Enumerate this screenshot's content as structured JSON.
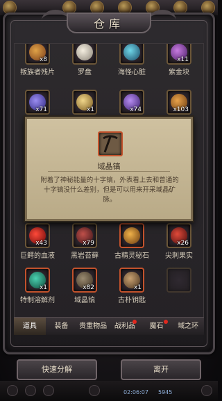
{
  "title": "仓库",
  "items": [
    {
      "name": "叛族者残片",
      "qty": "x8"
    },
    {
      "name": "罗盘",
      "qty": ""
    },
    {
      "name": "海怪心脏",
      "qty": ""
    },
    {
      "name": "紫金块",
      "qty": "x11"
    },
    {
      "name": "",
      "qty": "x71"
    },
    {
      "name": "",
      "qty": "x1"
    },
    {
      "name": "",
      "qty": "x74"
    },
    {
      "name": "",
      "qty": "x103"
    },
    {
      "name": "巨鳄的血液",
      "qty": "x43"
    },
    {
      "name": "黑岩苔藓",
      "qty": "x79"
    },
    {
      "name": "古精灵秘石",
      "qty": ""
    },
    {
      "name": "尖刺果实",
      "qty": "x26"
    },
    {
      "name": "特制溶解剂",
      "qty": "x1"
    },
    {
      "name": "域晶镐",
      "qty": "x82"
    },
    {
      "name": "古朴钥匙",
      "qty": "x1"
    },
    {
      "name": "",
      "qty": ""
    }
  ],
  "tooltip": {
    "name": "域晶镐",
    "desc": "附着了神秘能量的十字镐，外表看上去和普通的十字镐没什么差别，但是可以用来开采域晶矿脉。"
  },
  "tabs": [
    "道具",
    "装备",
    "贵重物品",
    "战利品",
    "魔石",
    "域之环"
  ],
  "buttons": {
    "quick_split": "快速分解",
    "leave": "离开"
  },
  "bottom": {
    "time": "02:06:07",
    "count": "5945"
  }
}
